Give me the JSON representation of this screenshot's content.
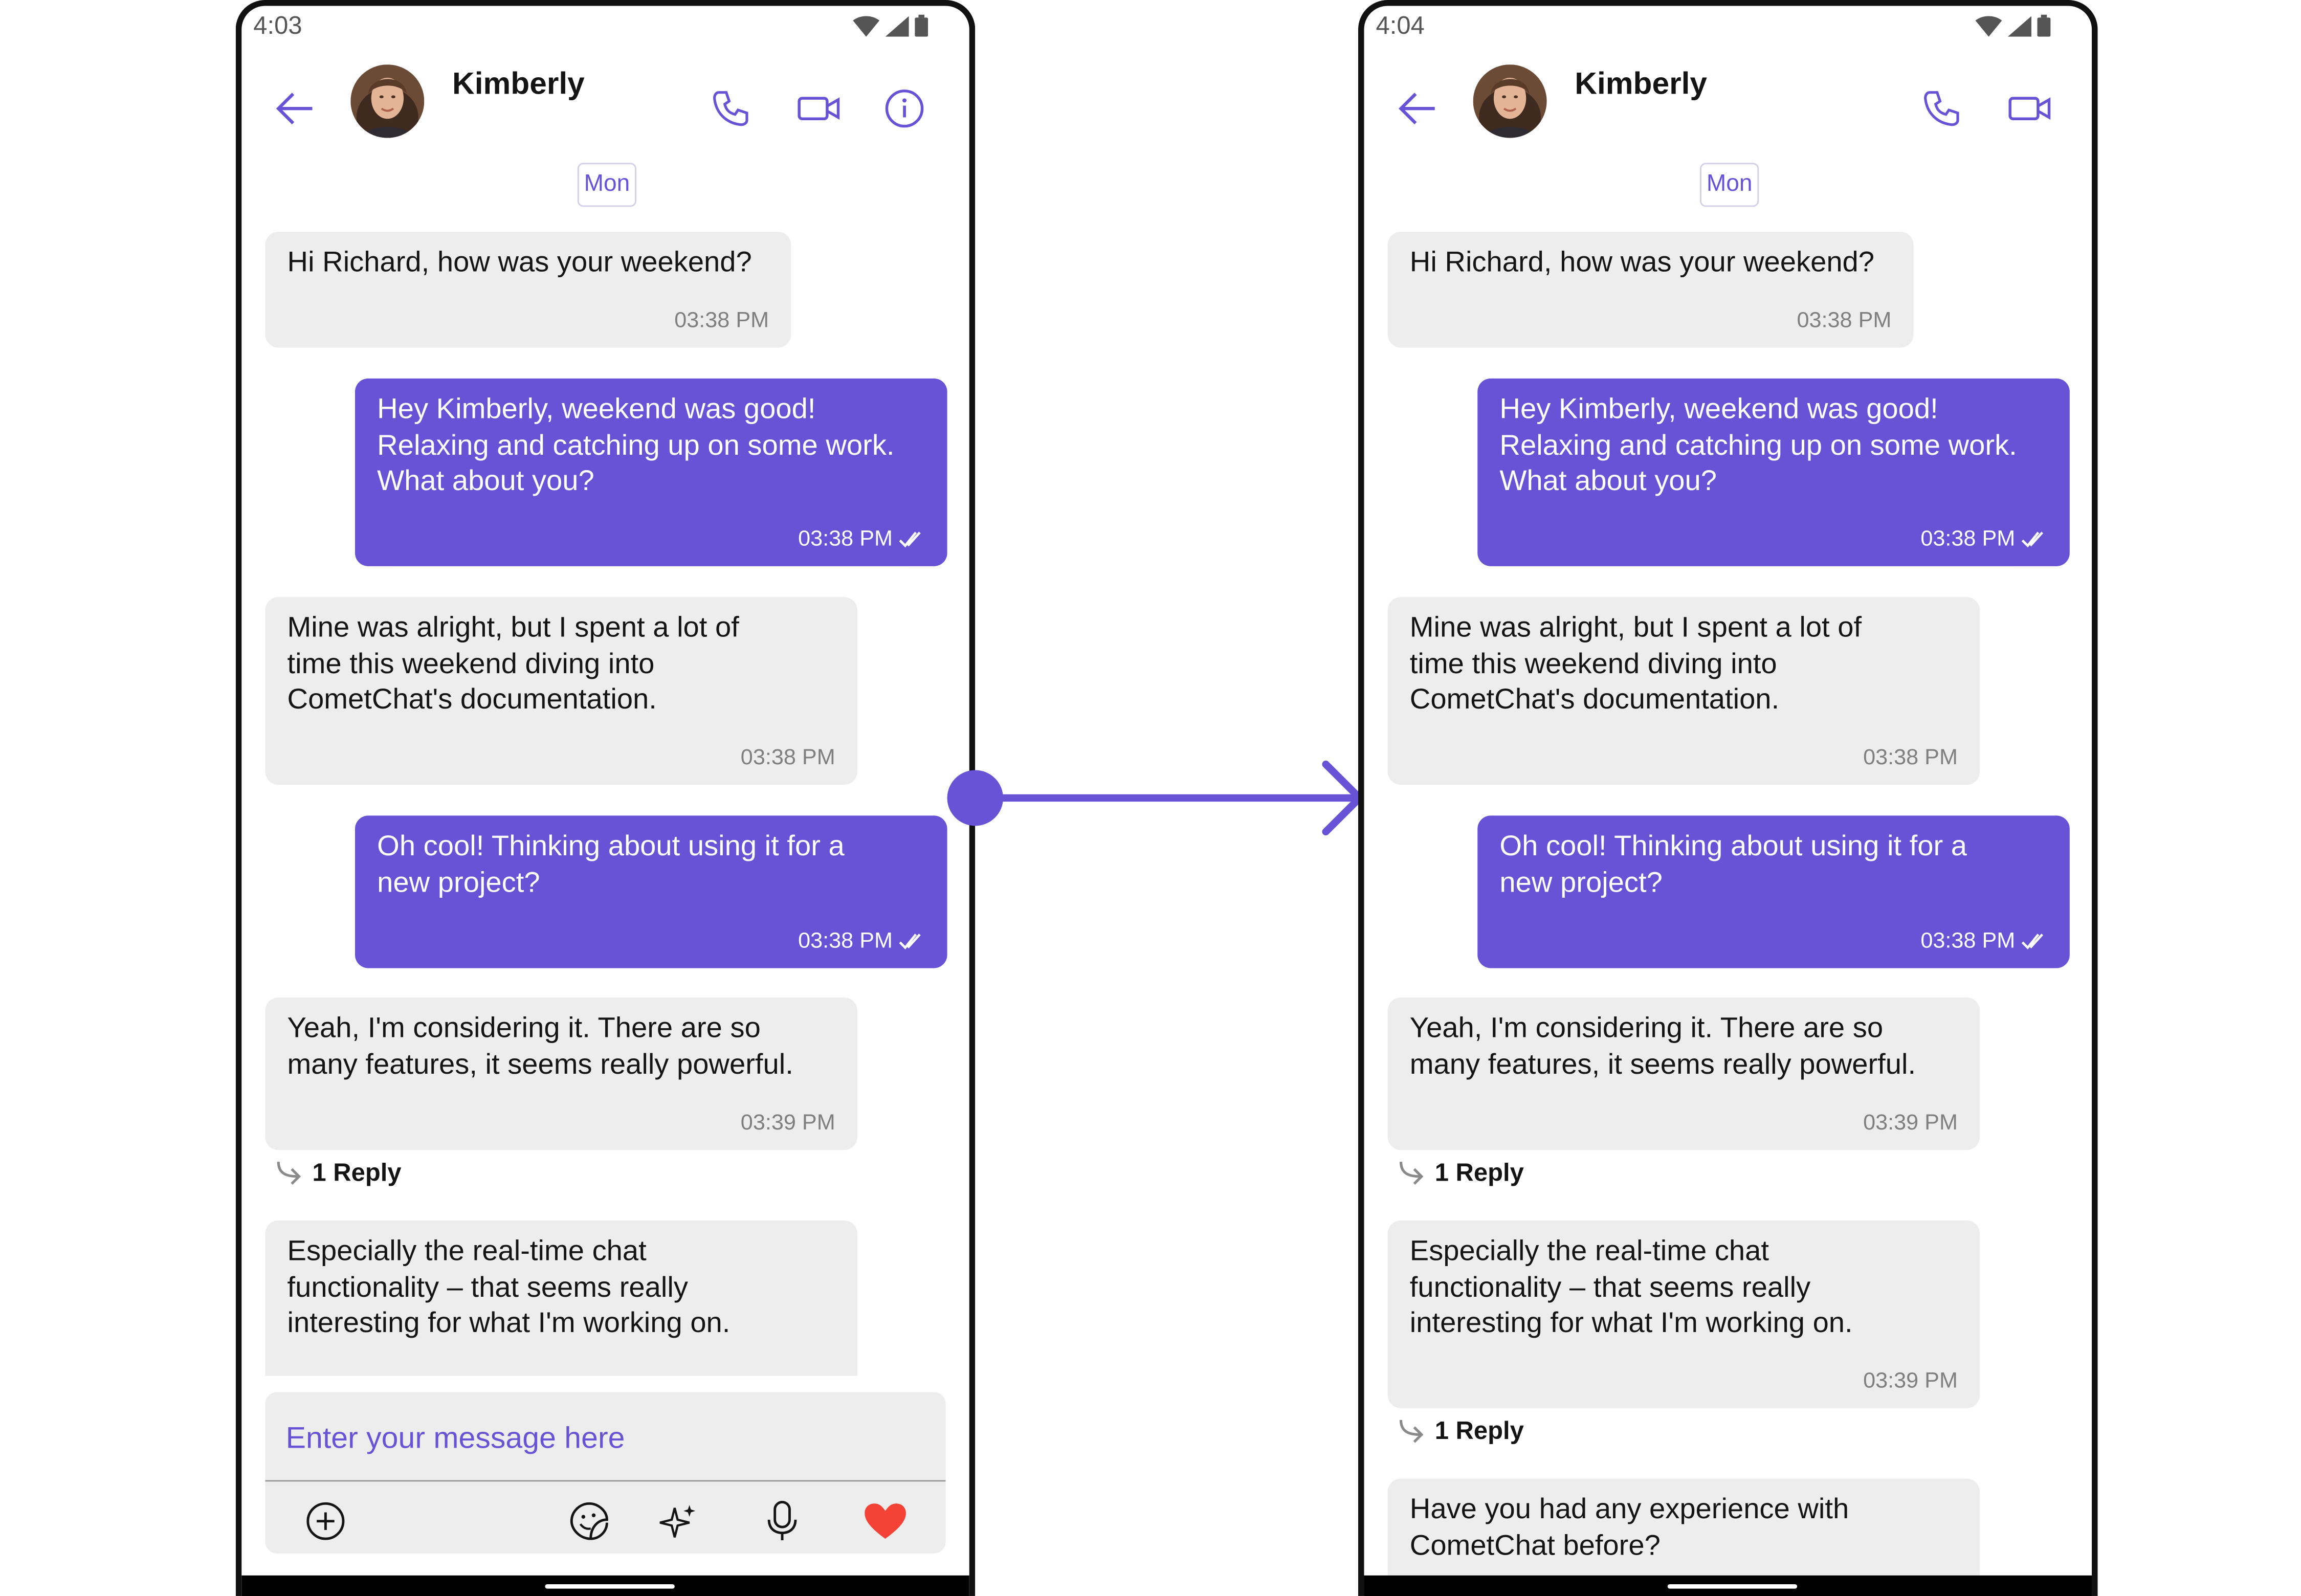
{
  "colors": {
    "accent": "#6852d6",
    "incoming_bubble": "#ededed",
    "outgoing_bubble": "#6852d6",
    "heart": "#f44336"
  },
  "phones": [
    {
      "status_time": "4:03",
      "header": {
        "name": "Kimberly",
        "icons": [
          "back-arrow-icon",
          "voice-call-icon",
          "video-call-icon",
          "info-icon"
        ]
      },
      "date_badge": "Mon",
      "messages": [
        {
          "text": "Hi Richard, how was your weekend?",
          "time": "03:38 PM"
        },
        {
          "text": "Hey Kimberly, weekend was good!\nRelaxing and catching up on some work.\nWhat about you?",
          "time": "03:38 PM"
        },
        {
          "text": "Mine was alright, but I spent a lot of\ntime this weekend diving into\nCometChat's documentation.",
          "time": "03:38 PM"
        },
        {
          "text": "Oh cool! Thinking about using it for a\nnew project?",
          "time": "03:38 PM"
        },
        {
          "text": "Yeah, I'm considering it.  There are so\nmany features, it seems really powerful.",
          "time": "03:39 PM",
          "reply": "1 Reply"
        },
        {
          "text": "Especially the real-time chat\nfunctionality – that seems really\ninteresting for what I'm working on."
        }
      ],
      "composer": {
        "placeholder": "Enter your message here",
        "icons": [
          "add-attachment-icon",
          "sticker-icon",
          "ai-sparkle-icon",
          "microphone-icon",
          "heart-icon"
        ]
      }
    },
    {
      "status_time": "4:04",
      "header": {
        "name": "Kimberly",
        "icons": [
          "back-arrow-icon",
          "voice-call-icon",
          "video-call-icon"
        ]
      },
      "date_badge": "Mon",
      "messages": [
        {
          "text": "Hi Richard, how was your weekend?",
          "time": "03:38 PM"
        },
        {
          "text": "Hey Kimberly, weekend was good!\nRelaxing and catching up on some work.\nWhat about you?",
          "time": "03:38 PM"
        },
        {
          "text": "Mine was alright, but I spent a lot of\ntime this weekend diving into\nCometChat's documentation.",
          "time": "03:38 PM"
        },
        {
          "text": "Oh cool! Thinking about using it for a\nnew project?",
          "time": "03:38 PM"
        },
        {
          "text": "Yeah, I'm considering it.  There are so\nmany features, it seems really powerful.",
          "time": "03:39 PM",
          "reply": "1 Reply"
        },
        {
          "text": "Especially the real-time chat\nfunctionality – that seems really\ninteresting for what I'm working on.",
          "time": "03:39 PM",
          "reply": "1 Reply"
        },
        {
          "text": "Have you had any experience with\nCometChat before?"
        }
      ]
    }
  ]
}
